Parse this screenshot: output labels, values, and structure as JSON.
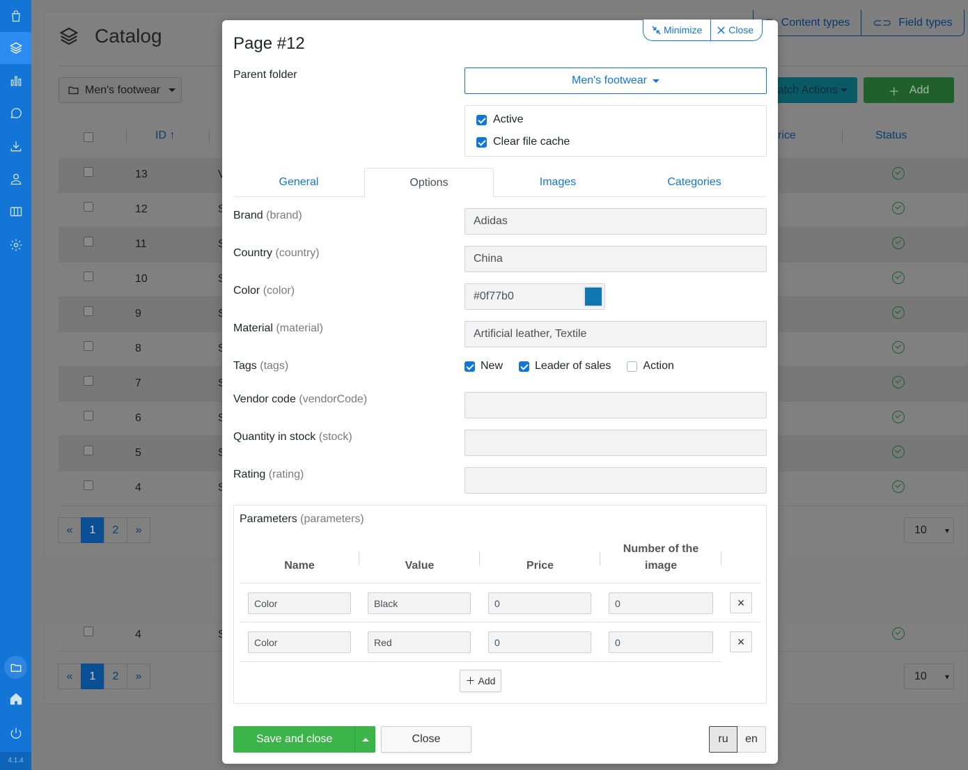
{
  "app": {
    "version": "4.1.4",
    "catalog_title": "Catalog",
    "folder_button": "Men's footwear",
    "top_tabs": [
      "Content types",
      "Field types"
    ],
    "batch_actions": "atch Actions",
    "add_label": "Add",
    "columns": {
      "id": "ID ↑",
      "price": "rice",
      "status": "Status"
    },
    "rows": [
      {
        "id": "13",
        "name": "V"
      },
      {
        "id": "12",
        "name": "S"
      },
      {
        "id": "11",
        "name": "S"
      },
      {
        "id": "10",
        "name": "S"
      },
      {
        "id": "9",
        "name": "S"
      },
      {
        "id": "8",
        "name": "S"
      },
      {
        "id": "7",
        "name": "S"
      },
      {
        "id": "6",
        "name": "S"
      },
      {
        "id": "5",
        "name": "S"
      },
      {
        "id": "4",
        "name": "S"
      }
    ],
    "pager": [
      "«",
      "1",
      "2",
      "»"
    ],
    "per_page": "10",
    "row2": {
      "id": "4",
      "name": "S"
    }
  },
  "modal": {
    "minimize_label": "Minimize",
    "close_label": "Close",
    "title": "Page #12",
    "parent_folder_label": "Parent folder",
    "parent_folder_value": "Men's footwear",
    "active_label": "Active",
    "clear_cache_label": "Clear file cache",
    "tabs": [
      "General",
      "Options",
      "Images",
      "Categories"
    ],
    "fields": {
      "brand": {
        "label": "Brand",
        "key": "(brand)",
        "value": "Adidas"
      },
      "country": {
        "label": "Country",
        "key": "(country)",
        "value": "China"
      },
      "color": {
        "label": "Color",
        "key": "(color)",
        "value": "#0f77b0"
      },
      "material": {
        "label": "Material",
        "key": "(material)",
        "value": "Artificial leather, Textile"
      },
      "tags": {
        "label": "Tags",
        "key": "(tags)",
        "options": [
          {
            "label": "New",
            "checked": true
          },
          {
            "label": "Leader of sales",
            "checked": true
          },
          {
            "label": "Action",
            "checked": false
          }
        ]
      },
      "vendor": {
        "label": "Vendor code",
        "key": "(vendorCode)",
        "value": ""
      },
      "stock": {
        "label": "Quantity in stock",
        "key": "(stock)",
        "value": ""
      },
      "rating": {
        "label": "Rating",
        "key": "(rating)",
        "value": ""
      }
    },
    "parameters": {
      "label": "Parameters",
      "key": "(parameters)",
      "headers": [
        "Name",
        "Value",
        "Price",
        "Number of the image"
      ],
      "rows": [
        [
          "Color",
          "Black",
          "0",
          "0"
        ],
        [
          "Color",
          "Red",
          "0",
          "0"
        ]
      ],
      "add_label": "Add"
    },
    "save_label": "Save and close",
    "close_button_label": "Close",
    "languages": [
      "ru",
      "en"
    ]
  },
  "colors": {
    "accent": "#1376d6",
    "success": "#3bb54a",
    "swatch": "#0f77b0"
  }
}
